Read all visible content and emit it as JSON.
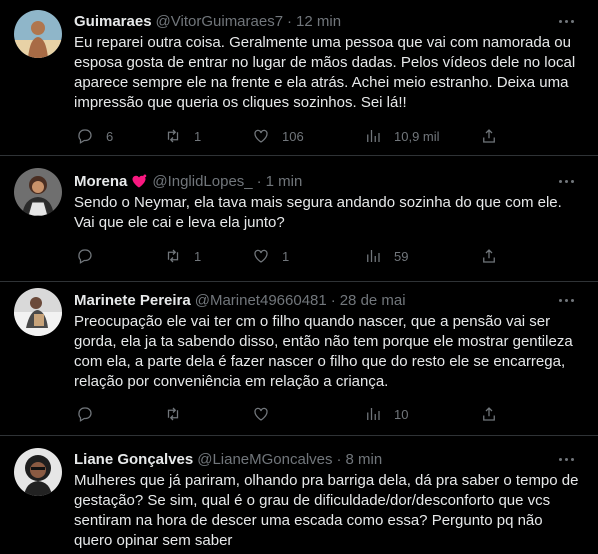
{
  "tweets": [
    {
      "name": "Guimaraes",
      "handle": "@VitorGuimaraes7",
      "dot": "·",
      "time": "12 min",
      "text": "Eu reparei outra coisa. Geralmente uma pessoa que vai com namorada ou esposa gosta de entrar no lugar de mãos dadas. Pelos vídeos dele no local aparece sempre ele na frente e ela atrás. Achei meio estranho. Deixa uma impressão que queria os cliques sozinhos. Sei lá!!",
      "replies": "6",
      "retweets": "1",
      "likes": "106",
      "views": "10,9 mil"
    },
    {
      "name": "Morena",
      "handle": "@InglidLopes_",
      "dot": "·",
      "time": "1 min",
      "text": "Sendo o Neymar, ela tava mais segura andando sozinha do que com ele. Vai que ele cai e leva ela junto?",
      "replies": "",
      "retweets": "1",
      "likes": "1",
      "views": "59"
    },
    {
      "name": "Marinete Pereira",
      "handle": "@Marinet49660481",
      "dot": "·",
      "time": "28 de mai",
      "text": "Preocupação ele vai ter cm o filho quando nascer, que a pensão vai ser gorda, ela ja ta sabendo disso, então não tem porque ele mostrar gentileza com ela, a parte dela é fazer nascer o filho que do resto ele se encarrega, relação por conveniência em relação a criança.",
      "replies": "",
      "retweets": "",
      "likes": "",
      "views": "10"
    },
    {
      "name": "Liane Gonçalves",
      "handle": "@LianeMGoncalves",
      "dot": "·",
      "time": "8 min",
      "text": "Mulheres que já pariram, olhando pra barriga dela, dá pra saber o tempo de gestação? Se sim, qual é o grau de dificuldade/dor/desconforto que vcs sentiram na hora de descer uma escada como essa? Pergunto pq não quero opinar sem saber"
    }
  ],
  "colors": {
    "background": "#000000",
    "text": "#e7e9ea",
    "muted": "#71767b",
    "border": "#2f3336",
    "heart_emoji": "#f91880"
  },
  "icons": [
    "reply-icon",
    "retweet-icon",
    "like-icon",
    "views-icon",
    "share-icon",
    "more-icon",
    "heart-emoji"
  ]
}
